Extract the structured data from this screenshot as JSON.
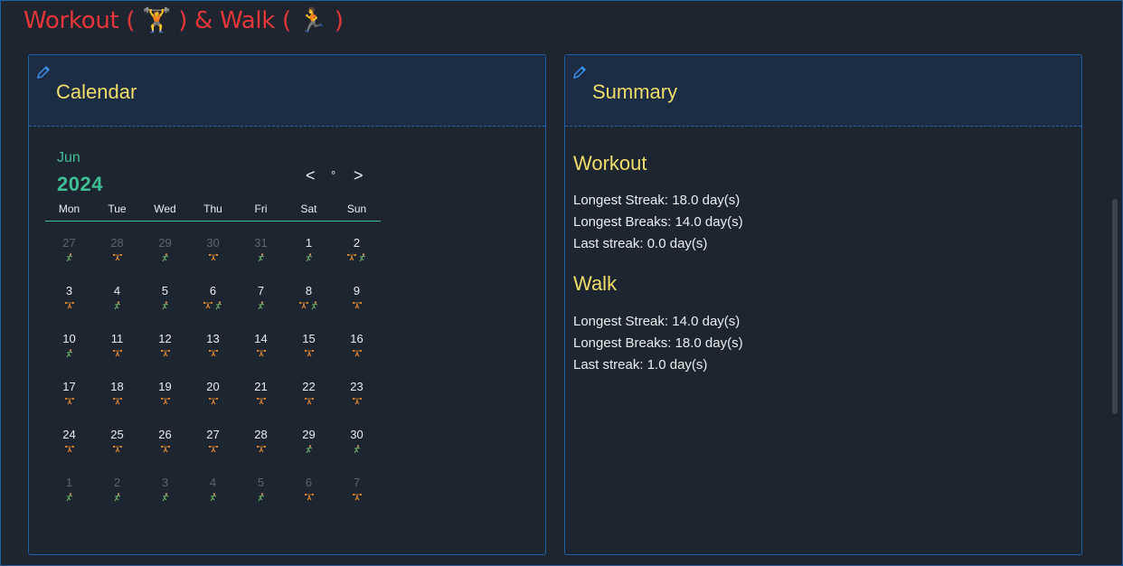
{
  "page_title": "Workout ( 🏋 ) & Walk ( 🏃 )",
  "calendar": {
    "title": "Calendar",
    "month": "Jun",
    "year": "2024",
    "nav_prev": "<",
    "nav_today": "°",
    "nav_next": ">",
    "weekdays": [
      "Mon",
      "Tue",
      "Wed",
      "Thu",
      "Fri",
      "Sat",
      "Sun"
    ],
    "weeks": [
      [
        {
          "d": "27",
          "other": true,
          "i": [
            "walk"
          ]
        },
        {
          "d": "28",
          "other": true,
          "i": [
            "workout"
          ]
        },
        {
          "d": "29",
          "other": true,
          "i": [
            "walk"
          ]
        },
        {
          "d": "30",
          "other": true,
          "i": [
            "workout"
          ]
        },
        {
          "d": "31",
          "other": true,
          "i": [
            "walk"
          ]
        },
        {
          "d": "1",
          "other": false,
          "i": [
            "walk"
          ]
        },
        {
          "d": "2",
          "other": false,
          "i": [
            "workout",
            "walk"
          ]
        }
      ],
      [
        {
          "d": "3",
          "other": false,
          "i": [
            "workout"
          ]
        },
        {
          "d": "4",
          "other": false,
          "i": [
            "walk"
          ]
        },
        {
          "d": "5",
          "other": false,
          "i": [
            "walk"
          ]
        },
        {
          "d": "6",
          "other": false,
          "i": [
            "workout",
            "walk"
          ]
        },
        {
          "d": "7",
          "other": false,
          "i": [
            "walk"
          ]
        },
        {
          "d": "8",
          "other": false,
          "i": [
            "workout",
            "walk"
          ]
        },
        {
          "d": "9",
          "other": false,
          "i": [
            "workout"
          ]
        }
      ],
      [
        {
          "d": "10",
          "other": false,
          "i": [
            "walk"
          ]
        },
        {
          "d": "11",
          "other": false,
          "i": [
            "workout"
          ]
        },
        {
          "d": "12",
          "other": false,
          "i": [
            "workout"
          ]
        },
        {
          "d": "13",
          "other": false,
          "i": [
            "workout"
          ]
        },
        {
          "d": "14",
          "other": false,
          "i": [
            "workout"
          ]
        },
        {
          "d": "15",
          "other": false,
          "i": [
            "workout"
          ]
        },
        {
          "d": "16",
          "other": false,
          "i": [
            "workout"
          ]
        }
      ],
      [
        {
          "d": "17",
          "other": false,
          "i": [
            "workout"
          ]
        },
        {
          "d": "18",
          "other": false,
          "i": [
            "workout"
          ]
        },
        {
          "d": "19",
          "other": false,
          "i": [
            "workout"
          ]
        },
        {
          "d": "20",
          "other": false,
          "i": [
            "workout"
          ]
        },
        {
          "d": "21",
          "other": false,
          "i": [
            "workout"
          ]
        },
        {
          "d": "22",
          "other": false,
          "i": [
            "workout"
          ]
        },
        {
          "d": "23",
          "other": false,
          "i": [
            "workout"
          ]
        }
      ],
      [
        {
          "d": "24",
          "other": false,
          "i": [
            "workout"
          ]
        },
        {
          "d": "25",
          "other": false,
          "i": [
            "workout"
          ]
        },
        {
          "d": "26",
          "other": false,
          "i": [
            "workout"
          ]
        },
        {
          "d": "27",
          "other": false,
          "i": [
            "workout"
          ]
        },
        {
          "d": "28",
          "other": false,
          "i": [
            "workout"
          ]
        },
        {
          "d": "29",
          "other": false,
          "i": [
            "walk"
          ]
        },
        {
          "d": "30",
          "other": false,
          "i": [
            "walk"
          ]
        }
      ],
      [
        {
          "d": "1",
          "other": true,
          "i": [
            "walk"
          ]
        },
        {
          "d": "2",
          "other": true,
          "i": [
            "walk"
          ]
        },
        {
          "d": "3",
          "other": true,
          "i": [
            "walk"
          ]
        },
        {
          "d": "4",
          "other": true,
          "i": [
            "walk"
          ]
        },
        {
          "d": "5",
          "other": true,
          "i": [
            "walk"
          ]
        },
        {
          "d": "6",
          "other": true,
          "i": [
            "workout"
          ]
        },
        {
          "d": "7",
          "other": true,
          "i": [
            "workout"
          ]
        }
      ]
    ]
  },
  "summary": {
    "title": "Summary",
    "workout": {
      "heading": "Workout",
      "longest_streak": "Longest Streak: 18.0 day(s)",
      "longest_breaks": "Longest Breaks: 14.0 day(s)",
      "last_streak": "Last streak: 0.0 day(s)"
    },
    "walk": {
      "heading": "Walk",
      "longest_streak": "Longest Streak: 14.0 day(s)",
      "longest_breaks": "Longest Breaks: 18.0 day(s)",
      "last_streak": "Last streak: 1.0 day(s)"
    }
  },
  "icons": {
    "edit": "pencil-icon",
    "workout": "weightlifter-icon",
    "walk": "runner-icon"
  },
  "colors": {
    "title_red": "#e5363a",
    "heading_yellow": "#f1de6a",
    "accent_green": "#3fbf95",
    "border_blue": "#1f5fa8"
  }
}
